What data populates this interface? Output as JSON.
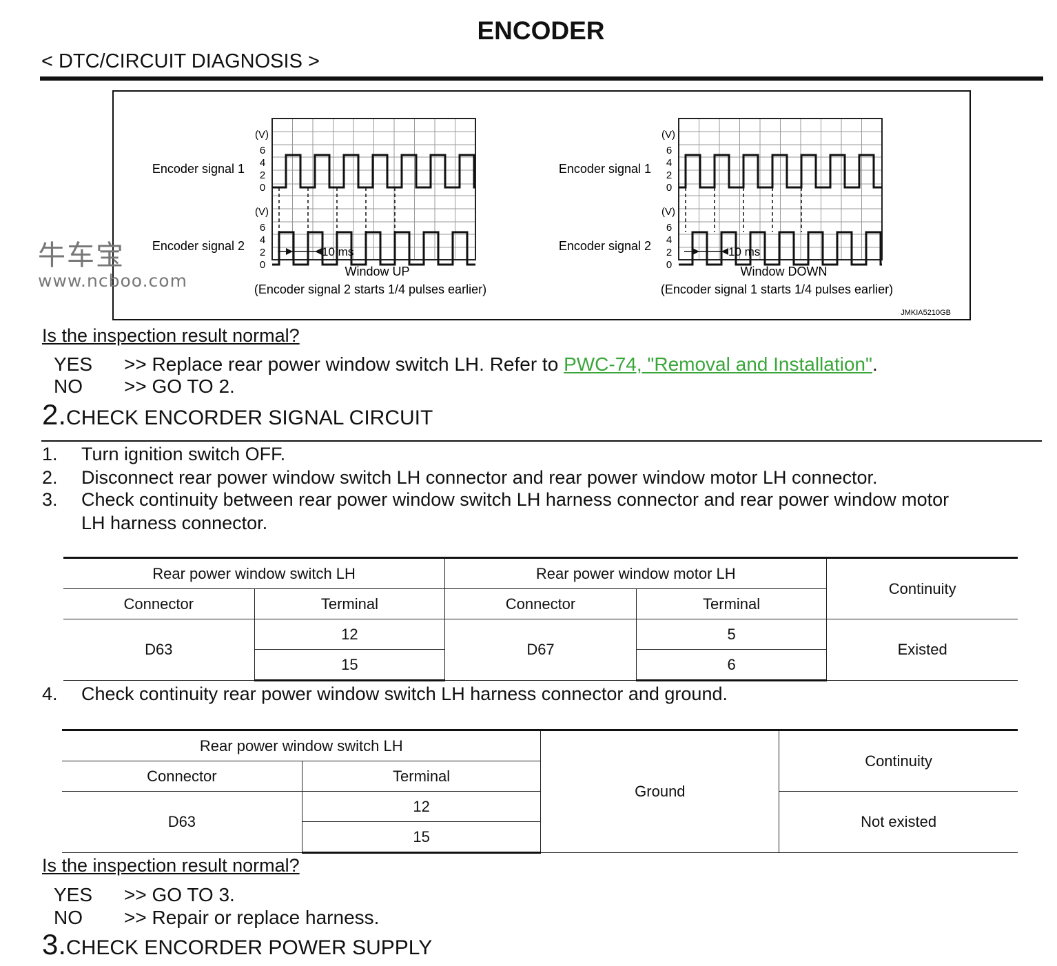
{
  "header": {
    "title": "ENCODER",
    "section": "< DTC/CIRCUIT DIAGNOSIS >"
  },
  "figure": {
    "panels": [
      {
        "caption": "Window UP",
        "note": "(Encoder signal 2 starts 1/4 pulses earlier)",
        "signal1_label": "Encoder signal 1",
        "signal2_label": "Encoder signal 2",
        "lead": "signal2"
      },
      {
        "caption": "Window DOWN",
        "note": "(Encoder signal 1 starts 1/4 pulses earlier)",
        "signal1_label": "Encoder signal 1",
        "signal2_label": "Encoder signal 2",
        "lead": "signal1"
      }
    ],
    "unit": "(V)",
    "ticks": [
      "6",
      "4",
      "2",
      "0"
    ],
    "time_label": "10 ms",
    "code": "JMKIA5210GB"
  },
  "watermark": {
    "cn": "牛车宝",
    "url": "www.ncboo.com"
  },
  "q1": {
    "question": "Is the inspection result normal?",
    "yes": "YES",
    "yes_text": ">> Replace rear power window switch LH. Refer to ",
    "yes_link": "PWC-74, \"Removal and Installation\"",
    "yes_end": ".",
    "no": "NO",
    "no_text": ">> GO TO 2."
  },
  "step2": {
    "num": "2.",
    "title": "CHECK ENCORDER SIGNAL CIRCUIT",
    "items": [
      {
        "n": "1.",
        "t": "Turn ignition switch OFF."
      },
      {
        "n": "2.",
        "t": "Disconnect rear power window switch LH connector and rear power window motor LH connector."
      },
      {
        "n": "3.",
        "t": "Check continuity between rear power window switch LH harness connector and rear power window motor",
        "t2": "LH harness connector."
      },
      {
        "n": "4.",
        "t": "Check continuity rear power window switch LH harness connector and ground."
      }
    ]
  },
  "table1": {
    "g1": "Rear power window switch LH",
    "g2": "Rear power window motor LH",
    "cont": "Continuity",
    "connector": "Connector",
    "terminal": "Terminal",
    "c1": "D63",
    "t1": [
      "12",
      "15"
    ],
    "c2": "D67",
    "t2": [
      "5",
      "6"
    ],
    "result": "Existed"
  },
  "table2": {
    "g1": "Rear power window switch LH",
    "connector": "Connector",
    "terminal": "Terminal",
    "c1": "D63",
    "t1": [
      "12",
      "15"
    ],
    "ground": "Ground",
    "cont": "Continuity",
    "result": "Not existed"
  },
  "q2": {
    "question": "Is the inspection result normal?",
    "yes": "YES",
    "yes_text": ">> GO TO 3.",
    "no": "NO",
    "no_text": ">> Repair or replace harness."
  },
  "step3": {
    "num": "3.",
    "title": "CHECK ENCORDER POWER SUPPLY"
  }
}
